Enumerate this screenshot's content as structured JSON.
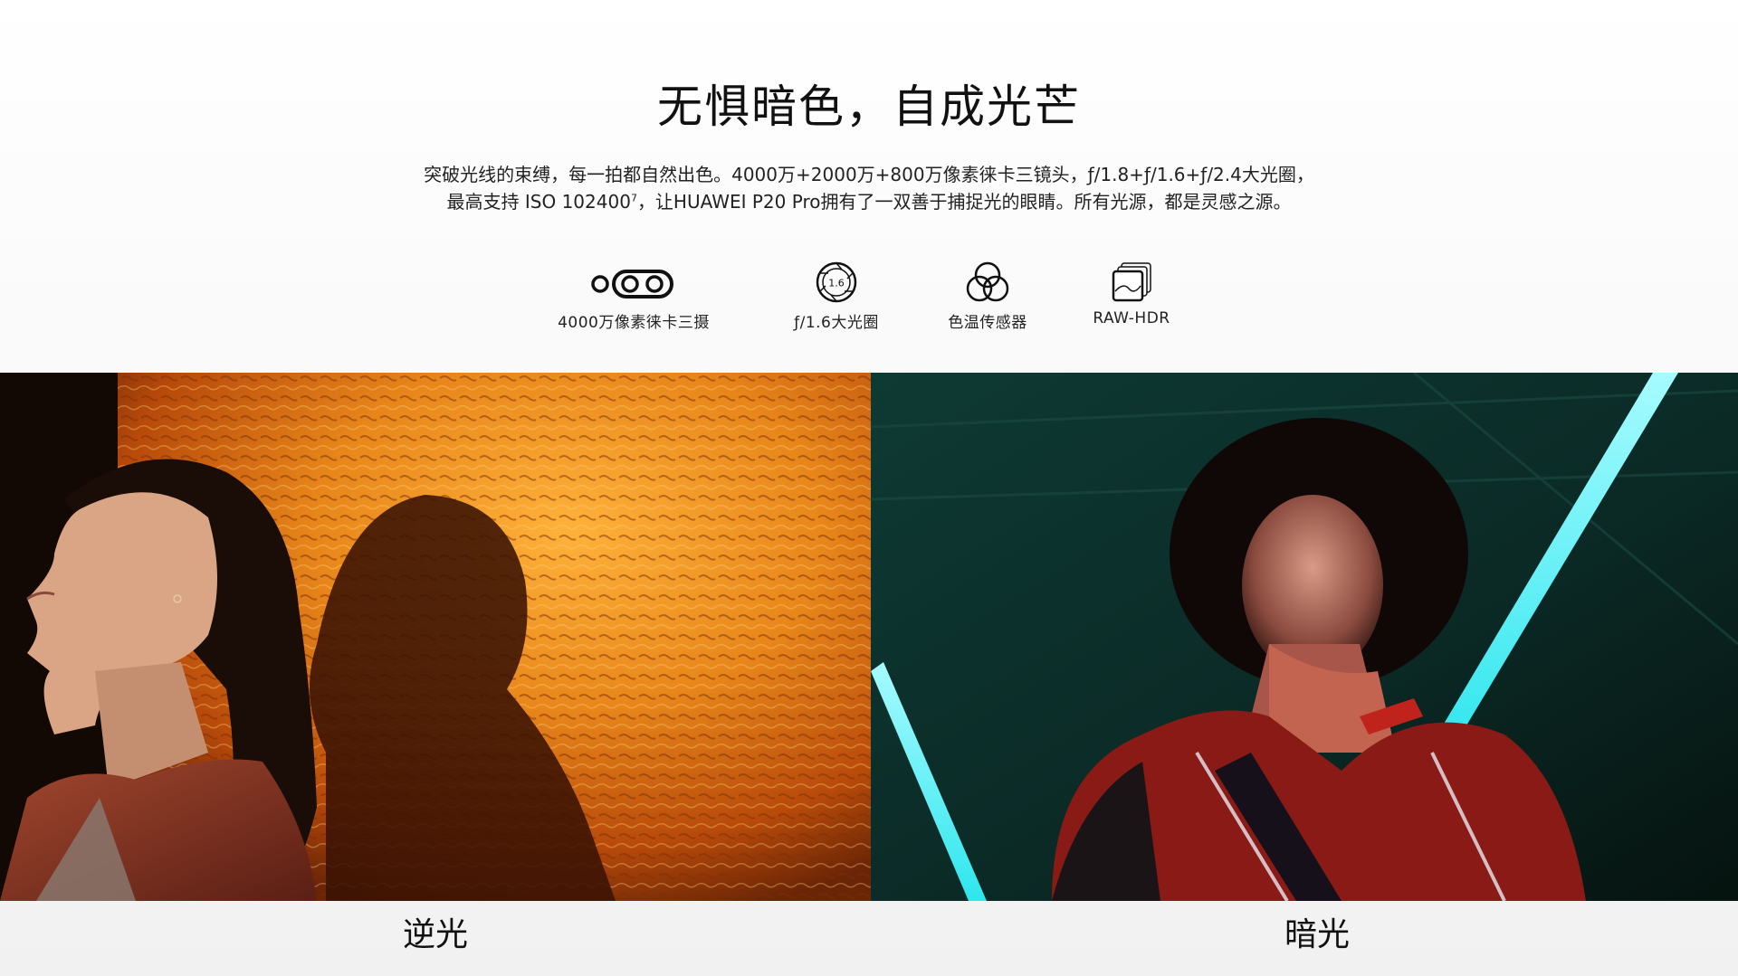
{
  "hero": {
    "title": "无惧暗色，自成光芒",
    "desc_line1": "突破光线的束缚，每一拍都自然出色。4000万+2000万+800万像素徕卡三镜头，ƒ/1.8+ƒ/1.6+ƒ/2.4大光圈，",
    "desc_line2_a": "最高支持 ISO 102400",
    "desc_line2_sup": "7",
    "desc_line2_b": "，让HUAWEI P20 Pro拥有了一双善于捕捉光的眼睛。所有光源，都是灵感之源。"
  },
  "features": [
    {
      "label": "4000万像素徕卡三摄",
      "icon": "triple-camera-icon"
    },
    {
      "label": "ƒ/1.6大光圈",
      "icon": "aperture-icon",
      "icon_text": "1.6"
    },
    {
      "label": "色温传感器",
      "icon": "color-sensor-icon"
    },
    {
      "label": "RAW-HDR",
      "icon": "raw-hdr-icon"
    }
  ],
  "photos": [
    {
      "caption": "逆光",
      "icon": "backlight-photo"
    },
    {
      "caption": "暗光",
      "icon": "lowlight-photo"
    }
  ],
  "colors": {
    "warm_wall": "#e8861a",
    "warm_deep": "#b84a0a",
    "dark_teal": "#0b3a34",
    "neon_cyan": "#2fe6ee",
    "jacket_red": "#c0221c"
  }
}
